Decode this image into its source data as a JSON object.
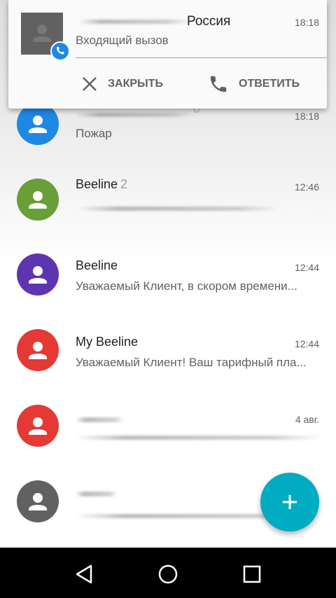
{
  "notification": {
    "caller": "Россия",
    "time": "18:18",
    "text": "Входящий вызов",
    "dismiss_label": "ЗАКРЫТЬ",
    "answer_label": "ОТВЕТИТЬ",
    "badge_color": "#1e88e5"
  },
  "conversations": [
    {
      "name": "",
      "count": "0",
      "time": "18:18",
      "snippet": "Пожар",
      "avatar_color": "#1e88e5"
    },
    {
      "name": "Beeline",
      "count": "2",
      "time": "12:46",
      "snippet": "",
      "avatar_color": "#689f38"
    },
    {
      "name": "Beeline",
      "count": "",
      "time": "12:44",
      "snippet": "Уважаемый Клиент, в скором времени...",
      "avatar_color": "#5e35b1"
    },
    {
      "name": "My Beeline",
      "count": "",
      "time": "12:44",
      "snippet": "Уважаемый Клиент! Ваш тарифный пла...",
      "avatar_color": "#e53935"
    },
    {
      "name": "",
      "count": "",
      "time": "4 авг.",
      "snippet": "",
      "avatar_color": "#e53935"
    },
    {
      "name": "",
      "count": "",
      "time": "",
      "snippet": "",
      "avatar_color": "#616161"
    }
  ],
  "fab": {
    "icon": "plus-icon",
    "color": "#00acc1"
  },
  "navbar": {
    "back_icon": "back-icon",
    "home_icon": "home-icon",
    "recents_icon": "recents-icon"
  }
}
